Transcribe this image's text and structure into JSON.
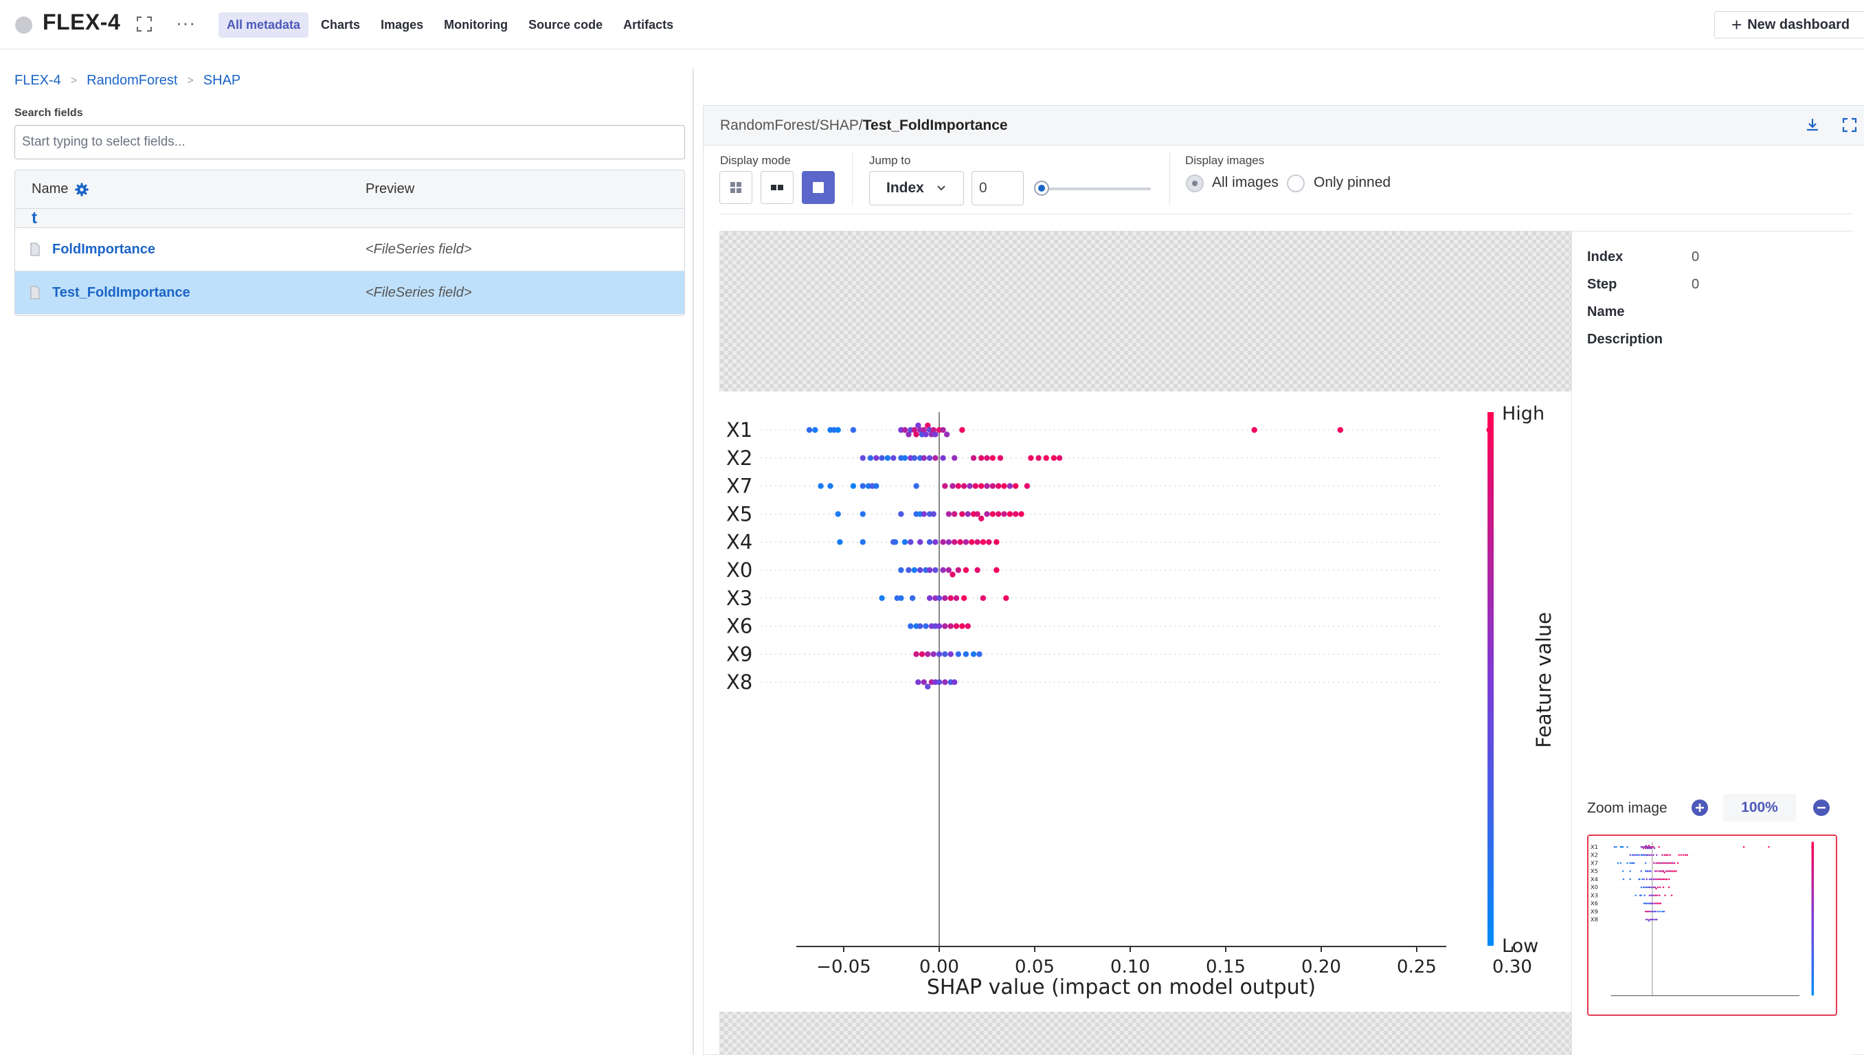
{
  "app": {
    "project_title": "FLEX-4",
    "nav_tabs": [
      "All metadata",
      "Charts",
      "Images",
      "Monitoring",
      "Source code",
      "Artifacts"
    ],
    "active_tab": "All metadata",
    "new_dashboard_label": "New dashboard"
  },
  "breadcrumb": [
    "FLEX-4",
    "RandomForest",
    "SHAP"
  ],
  "left_panel": {
    "search_label": "Search fields",
    "search_placeholder": "Start typing to select fields...",
    "columns": {
      "name": "Name",
      "preview": "Preview"
    },
    "up_label": "t",
    "rows": [
      {
        "name": "FoldImportance",
        "preview": "<FileSeries field>",
        "selected": false
      },
      {
        "name": "Test_FoldImportance",
        "preview": "<FileSeries field>",
        "selected": true
      }
    ]
  },
  "viewer": {
    "path_prefix": "RandomForest/SHAP/",
    "path_name": "Test_FoldImportance",
    "display_mode_label": "Display mode",
    "jump_to_label": "Jump to",
    "jump_select_value": "Index",
    "jump_input_value": "0",
    "display_images_label": "Display images",
    "radio_all": "All images",
    "radio_pinned": "Only pinned",
    "radio_selected": "All images",
    "slider_fraction": 0,
    "info": {
      "index_label": "Index",
      "index_value": "0",
      "step_label": "Step",
      "step_value": "0",
      "name_label": "Name",
      "description_label": "Description"
    },
    "zoom_label": "Zoom image",
    "zoom_value": "100%"
  },
  "colors": {
    "accent": "#5a66c9",
    "link": "#1b64c7",
    "selected_row": "#bfe0fa",
    "high": "#ff0052",
    "low": "#008bfb"
  },
  "chart_data": {
    "type": "scatter",
    "xlabel": "SHAP value (impact on model output)",
    "xlim": [
      -0.085,
      0.305
    ],
    "xticks": [
      "−0.05",
      "0.00",
      "0.05",
      "0.10",
      "0.15",
      "0.20",
      "0.25",
      "0.30"
    ],
    "xtick_values": [
      -0.05,
      0,
      0.05,
      0.1,
      0.15,
      0.2,
      0.25,
      0.3
    ],
    "colorbar": {
      "label": "Feature value",
      "high": "High",
      "low": "Low"
    },
    "features": [
      {
        "name": "X1",
        "points": [
          [
            -0.068,
            0.2
          ],
          [
            -0.065,
            0.1
          ],
          [
            -0.057,
            0.1
          ],
          [
            -0.055,
            0.15
          ],
          [
            -0.053,
            0.05
          ],
          [
            -0.045,
            0.2
          ],
          [
            -0.02,
            0.5
          ],
          [
            -0.018,
            0.7
          ],
          [
            -0.016,
            0.6
          ],
          [
            -0.015,
            0.4
          ],
          [
            -0.013,
            0.8
          ],
          [
            -0.012,
            0.9
          ],
          [
            -0.011,
            0.5
          ],
          [
            -0.01,
            0.6
          ],
          [
            -0.009,
            0.3
          ],
          [
            -0.008,
            0.7
          ],
          [
            -0.007,
            0.5
          ],
          [
            -0.006,
            0.9
          ],
          [
            -0.005,
            0.4
          ],
          [
            -0.004,
            0.6
          ],
          [
            -0.003,
            0.8
          ],
          [
            -0.002,
            0.5
          ],
          [
            0.0,
            0.9
          ],
          [
            0.002,
            0.7
          ],
          [
            0.004,
            0.6
          ],
          [
            0.012,
            0.95
          ],
          [
            0.165,
            0.95
          ],
          [
            0.21,
            0.95
          ],
          [
            0.288,
            0.95
          ]
        ]
      },
      {
        "name": "X2",
        "points": [
          [
            -0.04,
            0.4
          ],
          [
            -0.036,
            0.2
          ],
          [
            -0.033,
            0.5
          ],
          [
            -0.03,
            0.3
          ],
          [
            -0.027,
            0.1
          ],
          [
            -0.024,
            0.4
          ],
          [
            -0.02,
            0.2
          ],
          [
            -0.018,
            0.1
          ],
          [
            -0.015,
            0.5
          ],
          [
            -0.013,
            0.3
          ],
          [
            -0.01,
            0.2
          ],
          [
            -0.008,
            0.6
          ],
          [
            -0.005,
            0.4
          ],
          [
            -0.002,
            0.7
          ],
          [
            0.002,
            0.5
          ],
          [
            0.008,
            0.6
          ],
          [
            0.018,
            0.8
          ],
          [
            0.022,
            0.9
          ],
          [
            0.025,
            0.85
          ],
          [
            0.028,
            0.95
          ],
          [
            0.032,
            0.9
          ],
          [
            0.048,
            0.95
          ],
          [
            0.052,
            0.9
          ],
          [
            0.056,
            0.95
          ],
          [
            0.06,
            0.95
          ],
          [
            0.063,
            0.9
          ]
        ]
      },
      {
        "name": "X7",
        "points": [
          [
            -0.062,
            0.1
          ],
          [
            -0.057,
            0.1
          ],
          [
            -0.045,
            0.05
          ],
          [
            -0.04,
            0.2
          ],
          [
            -0.037,
            0.1
          ],
          [
            -0.035,
            0.3
          ],
          [
            -0.033,
            0.15
          ],
          [
            -0.012,
            0.2
          ],
          [
            0.003,
            0.8
          ],
          [
            0.007,
            0.7
          ],
          [
            0.01,
            0.9
          ],
          [
            0.013,
            0.85
          ],
          [
            0.016,
            0.6
          ],
          [
            0.019,
            0.9
          ],
          [
            0.022,
            0.95
          ],
          [
            0.025,
            0.7
          ],
          [
            0.028,
            0.8
          ],
          [
            0.031,
            0.9
          ],
          [
            0.034,
            0.95
          ],
          [
            0.037,
            0.6
          ],
          [
            0.04,
            0.95
          ],
          [
            0.046,
            0.9
          ]
        ]
      },
      {
        "name": "X5",
        "points": [
          [
            -0.053,
            0.1
          ],
          [
            -0.04,
            0.15
          ],
          [
            -0.02,
            0.3
          ],
          [
            -0.012,
            0.2
          ],
          [
            -0.01,
            0.1
          ],
          [
            -0.008,
            0.5
          ],
          [
            -0.005,
            0.3
          ],
          [
            -0.003,
            0.4
          ],
          [
            0.005,
            0.7
          ],
          [
            0.008,
            0.8
          ],
          [
            0.012,
            0.9
          ],
          [
            0.015,
            0.6
          ],
          [
            0.018,
            0.95
          ],
          [
            0.02,
            0.85
          ],
          [
            0.022,
            0.9
          ],
          [
            0.025,
            0.7
          ],
          [
            0.028,
            0.95
          ],
          [
            0.031,
            0.9
          ],
          [
            0.034,
            0.8
          ],
          [
            0.037,
            0.95
          ],
          [
            0.04,
            0.9
          ],
          [
            0.043,
            0.95
          ]
        ]
      },
      {
        "name": "X4",
        "points": [
          [
            -0.052,
            0.1
          ],
          [
            -0.04,
            0.15
          ],
          [
            -0.024,
            0.3
          ],
          [
            -0.023,
            0.2
          ],
          [
            -0.018,
            0.1
          ],
          [
            -0.015,
            0.4
          ],
          [
            -0.01,
            0.5
          ],
          [
            -0.005,
            0.3
          ],
          [
            -0.002,
            0.5
          ],
          [
            0.002,
            0.7
          ],
          [
            0.005,
            0.6
          ],
          [
            0.008,
            0.8
          ],
          [
            0.011,
            0.9
          ],
          [
            0.014,
            0.7
          ],
          [
            0.017,
            0.95
          ],
          [
            0.02,
            0.85
          ],
          [
            0.023,
            0.95
          ],
          [
            0.026,
            0.9
          ],
          [
            0.03,
            0.95
          ]
        ]
      },
      {
        "name": "X0",
        "points": [
          [
            -0.02,
            0.2
          ],
          [
            -0.016,
            0.3
          ],
          [
            -0.013,
            0.1
          ],
          [
            -0.01,
            0.4
          ],
          [
            -0.007,
            0.2
          ],
          [
            -0.005,
            0.5
          ],
          [
            -0.002,
            0.4
          ],
          [
            0.002,
            0.6
          ],
          [
            0.005,
            0.7
          ],
          [
            0.007,
            0.9
          ],
          [
            0.01,
            0.8
          ],
          [
            0.014,
            0.95
          ],
          [
            0.02,
            0.9
          ],
          [
            0.03,
            0.95
          ]
        ]
      },
      {
        "name": "X3",
        "points": [
          [
            -0.03,
            0.1
          ],
          [
            -0.022,
            0.2
          ],
          [
            -0.02,
            0.15
          ],
          [
            -0.014,
            0.2
          ],
          [
            -0.005,
            0.5
          ],
          [
            -0.002,
            0.6
          ],
          [
            0.0,
            0.4
          ],
          [
            0.003,
            0.7
          ],
          [
            0.006,
            0.9
          ],
          [
            0.009,
            0.8
          ],
          [
            0.013,
            0.95
          ],
          [
            0.023,
            0.9
          ],
          [
            0.035,
            0.95
          ]
        ]
      },
      {
        "name": "X6",
        "points": [
          [
            -0.015,
            0.2
          ],
          [
            -0.012,
            0.1
          ],
          [
            -0.01,
            0.3
          ],
          [
            -0.007,
            0.2
          ],
          [
            -0.004,
            0.5
          ],
          [
            -0.002,
            0.4
          ],
          [
            0.0,
            0.5
          ],
          [
            0.003,
            0.7
          ],
          [
            0.006,
            0.8
          ],
          [
            0.009,
            0.9
          ],
          [
            0.012,
            0.95
          ],
          [
            0.015,
            0.9
          ]
        ]
      },
      {
        "name": "X9",
        "points": [
          [
            -0.012,
            0.8
          ],
          [
            -0.009,
            0.9
          ],
          [
            -0.006,
            0.7
          ],
          [
            -0.003,
            0.6
          ],
          [
            0.0,
            0.4
          ],
          [
            0.003,
            0.3
          ],
          [
            0.006,
            0.5
          ],
          [
            0.01,
            0.2
          ],
          [
            0.014,
            0.15
          ],
          [
            0.018,
            0.1
          ],
          [
            0.021,
            0.2
          ]
        ]
      },
      {
        "name": "X8",
        "points": [
          [
            -0.011,
            0.5
          ],
          [
            -0.008,
            0.6
          ],
          [
            -0.006,
            0.4
          ],
          [
            -0.004,
            0.7
          ],
          [
            -0.002,
            0.5
          ],
          [
            0.0,
            0.4
          ],
          [
            0.003,
            0.6
          ],
          [
            0.006,
            0.3
          ],
          [
            0.008,
            0.5
          ]
        ]
      }
    ]
  }
}
